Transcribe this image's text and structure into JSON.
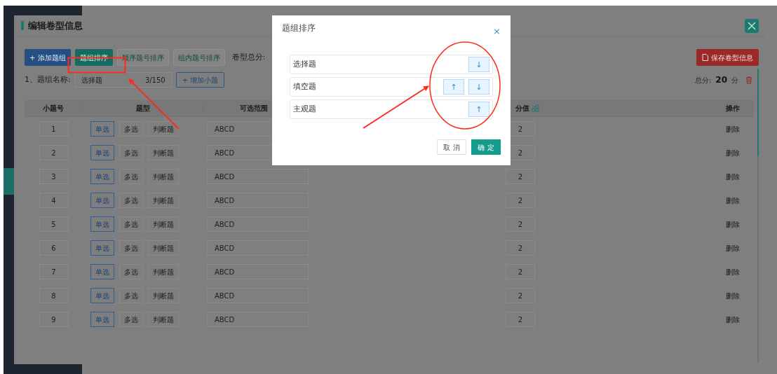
{
  "panel": {
    "title": "编辑卷型信息",
    "toolbar": [
      {
        "label": "+ 添加题组",
        "kind": "primary"
      },
      {
        "label": "题组排序",
        "kind": "accent"
      },
      {
        "label": "顺序题号排序",
        "kind": "outline"
      },
      {
        "label": "组内题号排序",
        "kind": "outline"
      }
    ],
    "total_label": "卷型总分:",
    "save_button": "保存卷型信息",
    "group": {
      "label": "1、题组名称:",
      "name_value": "选择题",
      "counter": "3/150",
      "add_button": "+ 增加小题",
      "score_label": "总分:",
      "score_value": "20",
      "score_unit": "分"
    },
    "table": {
      "columns": [
        "小题号",
        "题型",
        "可选范围",
        "分值",
        "操作"
      ],
      "rows": [
        {
          "number": "1",
          "types": [
            {
              "label": "单选",
              "selected": true
            },
            {
              "label": "多选",
              "selected": false
            },
            {
              "label": "判断题",
              "selected": false
            }
          ],
          "range": "ABCD",
          "score": "2",
          "action": "删除"
        },
        {
          "number": "2",
          "types": [
            {
              "label": "单选",
              "selected": true
            },
            {
              "label": "多选",
              "selected": false
            },
            {
              "label": "判断题",
              "selected": false
            }
          ],
          "range": "ABCD",
          "score": "2",
          "action": "删除"
        },
        {
          "number": "3",
          "types": [
            {
              "label": "单选",
              "selected": true
            },
            {
              "label": "多选",
              "selected": false
            },
            {
              "label": "判断题",
              "selected": false
            }
          ],
          "range": "ABCD",
          "score": "2",
          "action": "删除"
        },
        {
          "number": "4",
          "types": [
            {
              "label": "单选",
              "selected": true
            },
            {
              "label": "多选",
              "selected": false
            },
            {
              "label": "判断题",
              "selected": false
            }
          ],
          "range": "ABCD",
          "score": "2",
          "action": "删除"
        },
        {
          "number": "5",
          "types": [
            {
              "label": "单选",
              "selected": true
            },
            {
              "label": "多选",
              "selected": false
            },
            {
              "label": "判断题",
              "selected": false
            }
          ],
          "range": "ABCD",
          "score": "2",
          "action": "删除"
        },
        {
          "number": "6",
          "types": [
            {
              "label": "单选",
              "selected": true
            },
            {
              "label": "多选",
              "selected": false
            },
            {
              "label": "判断题",
              "selected": false
            }
          ],
          "range": "ABCD",
          "score": "2",
          "action": "删除"
        },
        {
          "number": "7",
          "types": [
            {
              "label": "单选",
              "selected": true
            },
            {
              "label": "多选",
              "selected": false
            },
            {
              "label": "判断题",
              "selected": false
            }
          ],
          "range": "ABCD",
          "score": "2",
          "action": "删除"
        },
        {
          "number": "8",
          "types": [
            {
              "label": "单选",
              "selected": true
            },
            {
              "label": "多选",
              "selected": false
            },
            {
              "label": "判断题",
              "selected": false
            }
          ],
          "range": "ABCD",
          "score": "2",
          "action": "删除"
        },
        {
          "number": "9",
          "types": [
            {
              "label": "单选",
              "selected": true
            },
            {
              "label": "多选",
              "selected": false
            },
            {
              "label": "判断题",
              "selected": false
            }
          ],
          "range": "ABCD",
          "score": "2",
          "action": "删除"
        }
      ]
    }
  },
  "dialog": {
    "title": "题组排序",
    "close": "×",
    "items": [
      {
        "label": "选择题",
        "buttons": [
          "↓"
        ]
      },
      {
        "label": "填空题",
        "buttons": [
          "↑",
          "↓"
        ]
      },
      {
        "label": "主观题",
        "buttons": [
          "↑"
        ]
      }
    ],
    "cancel": "取 消",
    "confirm": "确 定"
  }
}
